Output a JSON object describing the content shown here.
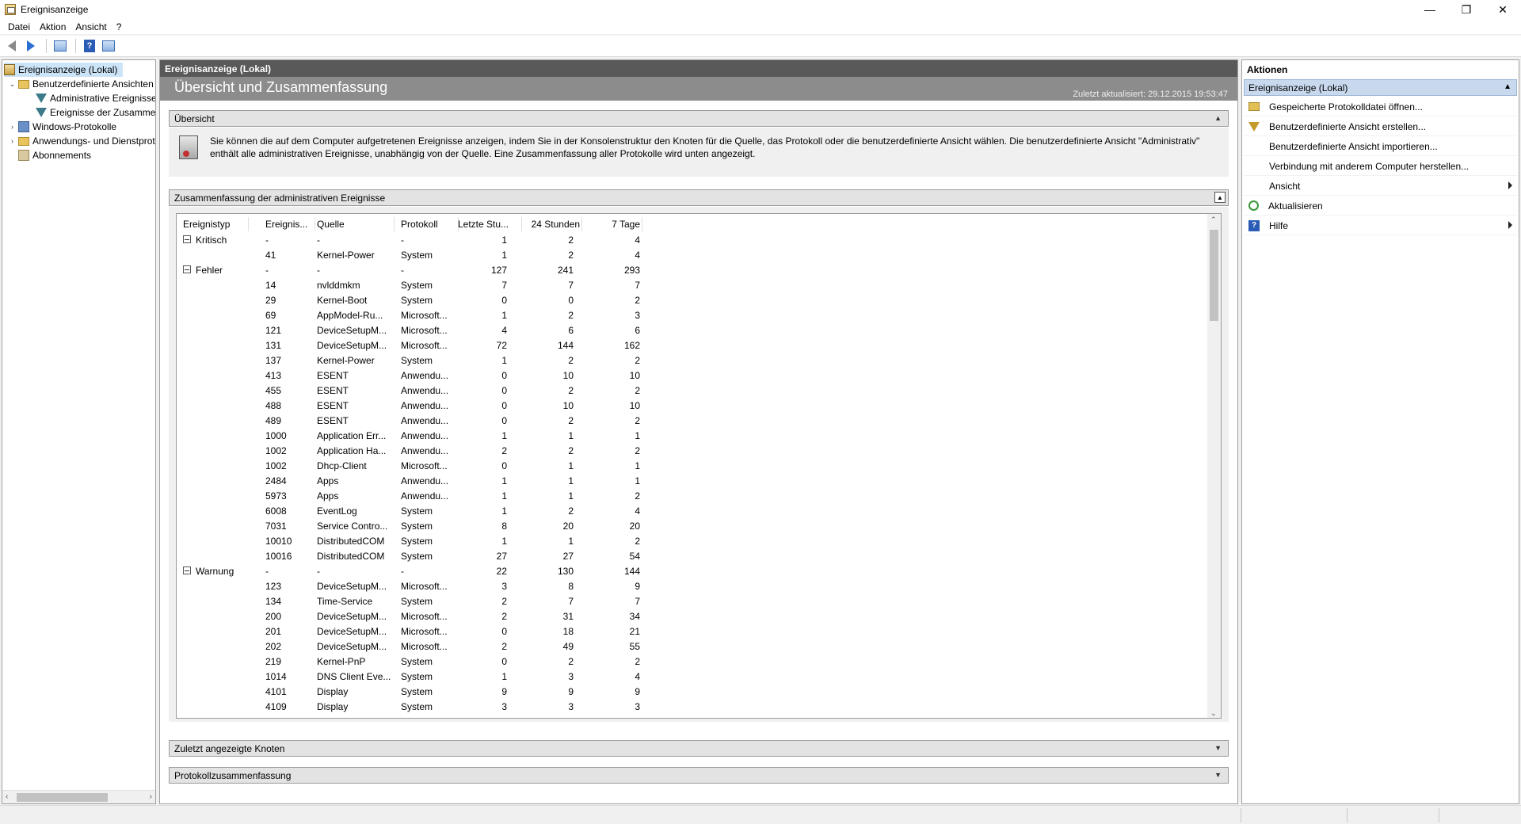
{
  "window": {
    "title": "Ereignisanzeige",
    "controls": [
      "—",
      "❐",
      "✕"
    ]
  },
  "menu": [
    "Datei",
    "Aktion",
    "Ansicht",
    "?"
  ],
  "tree": {
    "root": "Ereignisanzeige (Lokal)",
    "custom_views": "Benutzerdefinierte Ansichten",
    "admin_events": "Administrative Ereignisse",
    "summary_events": "Ereignisse der Zusammenfassung",
    "windows_logs": "Windows-Protokolle",
    "app_logs": "Anwendungs- und Dienstprotokolle",
    "subscriptions": "Abonnements"
  },
  "center": {
    "header": "Ereignisanzeige (Lokal)",
    "title": "Übersicht und Zusammenfassung",
    "updated": "Zuletzt aktualisiert: 29.12.2015 19:53:47",
    "overview_label": "Übersicht",
    "overview_text": "Sie können die auf dem Computer aufgetretenen Ereignisse anzeigen, indem Sie in der Konsolenstruktur den Knoten für die Quelle, das Protokoll oder die benutzerdefinierte Ansicht wählen. Die benutzerdefinierte Ansicht \"Administrativ\" enthält alle administrativen Ereignisse, unabhängig von der Quelle. Eine Zusammenfassung aller Protokolle wird unten angezeigt.",
    "summary_label": "Zusammenfassung der administrativen Ereignisse",
    "recent_label": "Zuletzt angezeigte Knoten",
    "logsummary_label": "Protokollzusammenfassung"
  },
  "table": {
    "columns": [
      "Ereignistyp",
      "Ereignis...",
      "Quelle",
      "Protokoll",
      "Letzte Stu...",
      "24 Stunden",
      "7 Tage"
    ],
    "rows": [
      {
        "type": "Kritisch",
        "id": "-",
        "source": "-",
        "log": "-",
        "h1": "1",
        "h24": "2",
        "d7": "4",
        "group": true
      },
      {
        "type": "",
        "id": "41",
        "source": "Kernel-Power",
        "log": "System",
        "h1": "1",
        "h24": "2",
        "d7": "4"
      },
      {
        "type": "Fehler",
        "id": "-",
        "source": "-",
        "log": "-",
        "h1": "127",
        "h24": "241",
        "d7": "293",
        "group": true
      },
      {
        "type": "",
        "id": "14",
        "source": "nvlddmkm",
        "log": "System",
        "h1": "7",
        "h24": "7",
        "d7": "7"
      },
      {
        "type": "",
        "id": "29",
        "source": "Kernel-Boot",
        "log": "System",
        "h1": "0",
        "h24": "0",
        "d7": "2"
      },
      {
        "type": "",
        "id": "69",
        "source": "AppModel-Ru...",
        "log": "Microsoft...",
        "h1": "1",
        "h24": "2",
        "d7": "3"
      },
      {
        "type": "",
        "id": "121",
        "source": "DeviceSetupM...",
        "log": "Microsoft...",
        "h1": "4",
        "h24": "6",
        "d7": "6"
      },
      {
        "type": "",
        "id": "131",
        "source": "DeviceSetupM...",
        "log": "Microsoft...",
        "h1": "72",
        "h24": "144",
        "d7": "162"
      },
      {
        "type": "",
        "id": "137",
        "source": "Kernel-Power",
        "log": "System",
        "h1": "1",
        "h24": "2",
        "d7": "2"
      },
      {
        "type": "",
        "id": "413",
        "source": "ESENT",
        "log": "Anwendu...",
        "h1": "0",
        "h24": "10",
        "d7": "10"
      },
      {
        "type": "",
        "id": "455",
        "source": "ESENT",
        "log": "Anwendu...",
        "h1": "0",
        "h24": "2",
        "d7": "2"
      },
      {
        "type": "",
        "id": "488",
        "source": "ESENT",
        "log": "Anwendu...",
        "h1": "0",
        "h24": "10",
        "d7": "10"
      },
      {
        "type": "",
        "id": "489",
        "source": "ESENT",
        "log": "Anwendu...",
        "h1": "0",
        "h24": "2",
        "d7": "2"
      },
      {
        "type": "",
        "id": "1000",
        "source": "Application Err...",
        "log": "Anwendu...",
        "h1": "1",
        "h24": "1",
        "d7": "1"
      },
      {
        "type": "",
        "id": "1002",
        "source": "Application Ha...",
        "log": "Anwendu...",
        "h1": "2",
        "h24": "2",
        "d7": "2"
      },
      {
        "type": "",
        "id": "1002",
        "source": "Dhcp-Client",
        "log": "Microsoft...",
        "h1": "0",
        "h24": "1",
        "d7": "1"
      },
      {
        "type": "",
        "id": "2484",
        "source": "Apps",
        "log": "Anwendu...",
        "h1": "1",
        "h24": "1",
        "d7": "1"
      },
      {
        "type": "",
        "id": "5973",
        "source": "Apps",
        "log": "Anwendu...",
        "h1": "1",
        "h24": "1",
        "d7": "2"
      },
      {
        "type": "",
        "id": "6008",
        "source": "EventLog",
        "log": "System",
        "h1": "1",
        "h24": "2",
        "d7": "4"
      },
      {
        "type": "",
        "id": "7031",
        "source": "Service Contro...",
        "log": "System",
        "h1": "8",
        "h24": "20",
        "d7": "20"
      },
      {
        "type": "",
        "id": "10010",
        "source": "DistributedCOM",
        "log": "System",
        "h1": "1",
        "h24": "1",
        "d7": "2"
      },
      {
        "type": "",
        "id": "10016",
        "source": "DistributedCOM",
        "log": "System",
        "h1": "27",
        "h24": "27",
        "d7": "54"
      },
      {
        "type": "Warnung",
        "id": "-",
        "source": "-",
        "log": "-",
        "h1": "22",
        "h24": "130",
        "d7": "144",
        "group": true
      },
      {
        "type": "",
        "id": "123",
        "source": "DeviceSetupM...",
        "log": "Microsoft...",
        "h1": "3",
        "h24": "8",
        "d7": "9"
      },
      {
        "type": "",
        "id": "134",
        "source": "Time-Service",
        "log": "System",
        "h1": "2",
        "h24": "7",
        "d7": "7"
      },
      {
        "type": "",
        "id": "200",
        "source": "DeviceSetupM...",
        "log": "Microsoft...",
        "h1": "2",
        "h24": "31",
        "d7": "34"
      },
      {
        "type": "",
        "id": "201",
        "source": "DeviceSetupM...",
        "log": "Microsoft...",
        "h1": "0",
        "h24": "18",
        "d7": "21"
      },
      {
        "type": "",
        "id": "202",
        "source": "DeviceSetupM...",
        "log": "Microsoft...",
        "h1": "2",
        "h24": "49",
        "d7": "55"
      },
      {
        "type": "",
        "id": "219",
        "source": "Kernel-PnP",
        "log": "System",
        "h1": "0",
        "h24": "2",
        "d7": "2"
      },
      {
        "type": "",
        "id": "1014",
        "source": "DNS Client Eve...",
        "log": "System",
        "h1": "1",
        "h24": "3",
        "d7": "4"
      },
      {
        "type": "",
        "id": "4101",
        "source": "Display",
        "log": "System",
        "h1": "9",
        "h24": "9",
        "d7": "9"
      },
      {
        "type": "",
        "id": "4109",
        "source": "Display",
        "log": "System",
        "h1": "3",
        "h24": "3",
        "d7": "3"
      }
    ]
  },
  "actions": {
    "header": "Aktionen",
    "section": "Ereignisanzeige (Lokal)",
    "items": [
      {
        "label": "Gespeicherte Protokolldatei öffnen...",
        "icon": "open-folder-icon"
      },
      {
        "label": "Benutzerdefinierte Ansicht erstellen...",
        "icon": "filter-icon"
      },
      {
        "label": "Benutzerdefinierte Ansicht importieren...",
        "icon": ""
      },
      {
        "label": "Verbindung mit anderem Computer herstellen...",
        "icon": ""
      },
      {
        "label": "Ansicht",
        "icon": "",
        "submenu": true
      },
      {
        "label": "Aktualisieren",
        "icon": "refresh-icon"
      },
      {
        "label": "Hilfe",
        "icon": "help-icon",
        "submenu": true
      }
    ]
  }
}
